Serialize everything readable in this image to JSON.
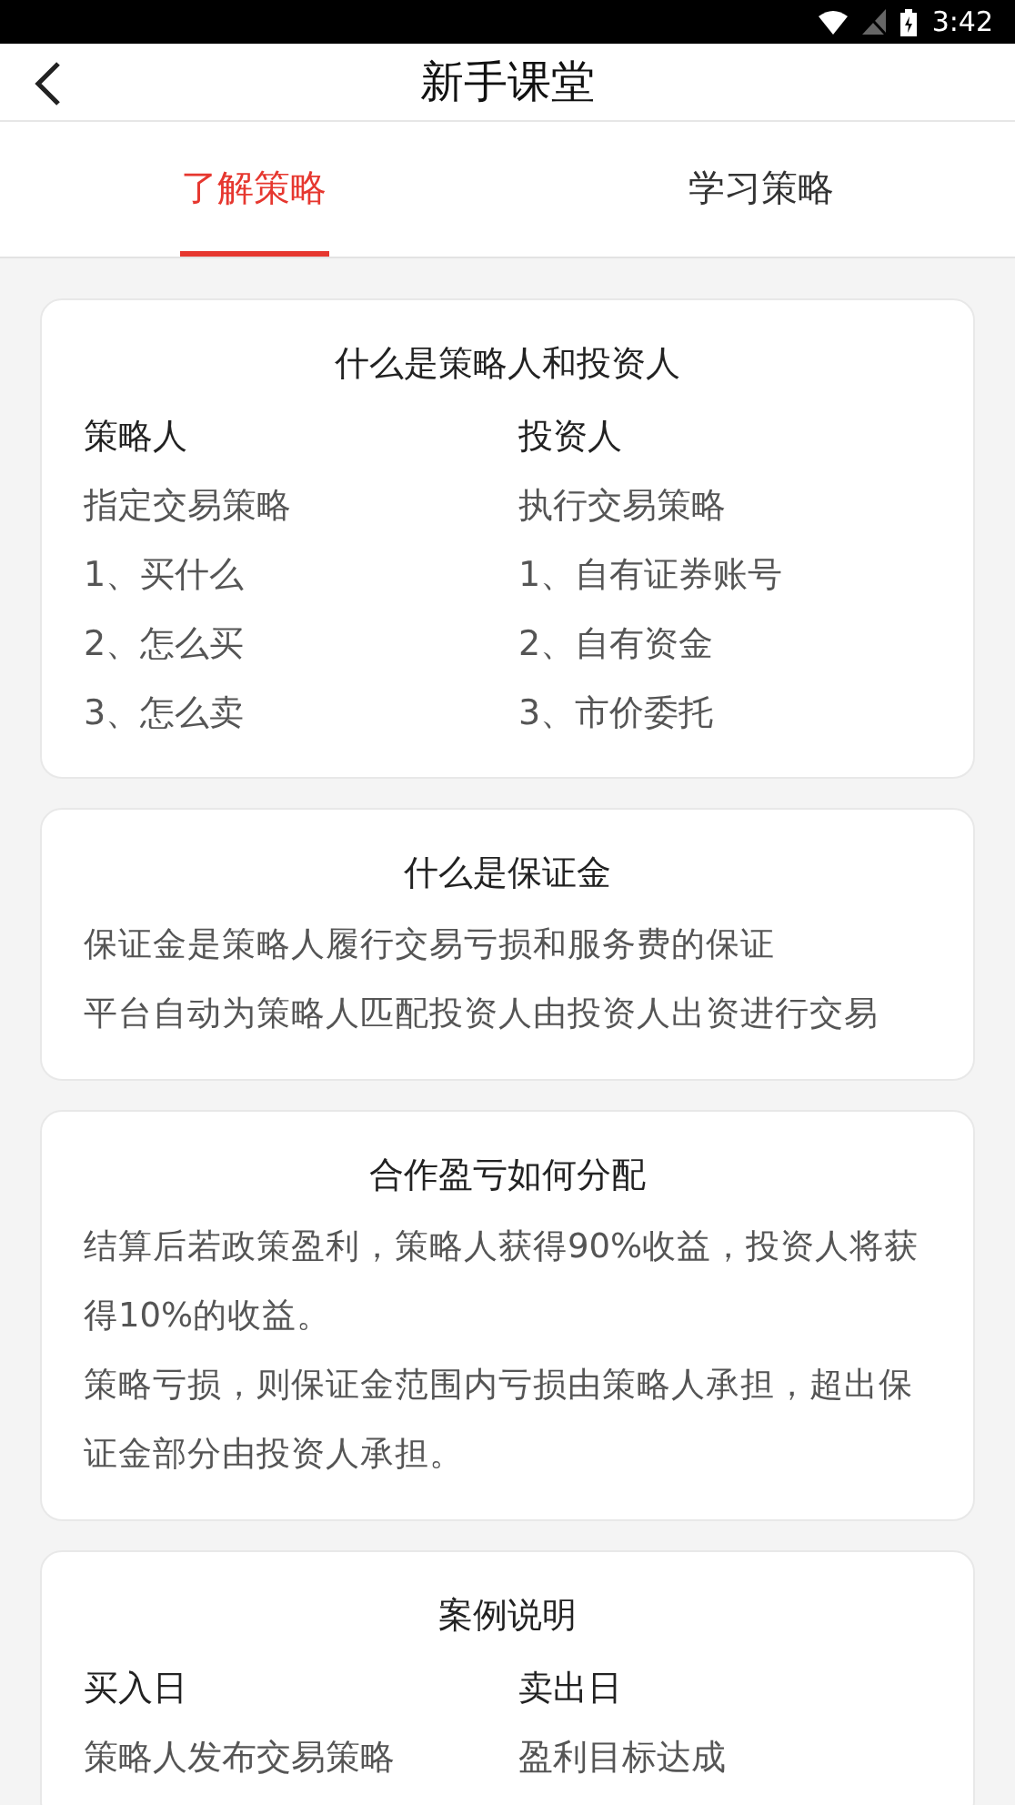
{
  "status_bar": {
    "time": "3:42"
  },
  "header": {
    "title": "新手课堂"
  },
  "tabs": [
    {
      "label": "了解策略",
      "selected": true
    },
    {
      "label": "学习策略",
      "selected": false
    }
  ],
  "cards": [
    {
      "kind": "columns",
      "title": "什么是策略人和投资人",
      "columns": [
        {
          "heading": "策略人",
          "lines": [
            "指定交易策略",
            "1、买什么",
            "2、怎么买",
            "3、怎么卖"
          ]
        },
        {
          "heading": "投资人",
          "lines": [
            "执行交易策略",
            "1、自有证券账号",
            "2、自有资金",
            "3、市价委托"
          ]
        }
      ]
    },
    {
      "kind": "paragraphs",
      "title": "什么是保证金",
      "paragraphs": [
        "保证金是策略人履行交易亏损和服务费的保证",
        "平台自动为策略人匹配投资人由投资人出资进行交易"
      ]
    },
    {
      "kind": "paragraphs",
      "title": "合作盈亏如何分配",
      "paragraphs": [
        "结算后若政策盈利，策略人获得90%收益，投资人将获得10%的收益。",
        "策略亏损，则保证金范围内亏损由策略人承担，超出保证金部分由投资人承担。"
      ]
    },
    {
      "kind": "columns",
      "title": "案例说明",
      "columns": [
        {
          "heading": "买入日",
          "lines": [
            "策略人发布交易策略"
          ]
        },
        {
          "heading": "卖出日",
          "lines": [
            "盈利目标达成"
          ]
        }
      ]
    }
  ]
}
